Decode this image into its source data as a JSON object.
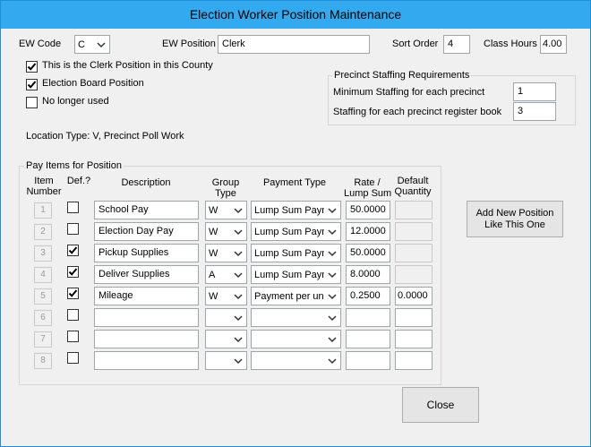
{
  "window": {
    "title": "Election Worker Position Maintenance"
  },
  "header": {
    "ew_code_label": "EW Code",
    "ew_code_value": "C",
    "ew_position_label": "EW Position",
    "ew_position_value": "Clerk",
    "sort_order_label": "Sort Order",
    "sort_order_value": "4",
    "class_hours_label": "Class Hours",
    "class_hours_value": "4.00"
  },
  "options": [
    {
      "label": "This is the Clerk Position in this County",
      "checked": true
    },
    {
      "label": "Election Board Position",
      "checked": true
    },
    {
      "label": "No longer used",
      "checked": false
    }
  ],
  "staffing": {
    "title": "Precinct Staffing Requirements",
    "min_label": "Minimum Staffing for each precinct",
    "min_value": "1",
    "book_label": "Staffing for each precinct register book",
    "book_value": "3"
  },
  "location_type": "Location Type: V, Precinct Poll Work",
  "pay_items": {
    "title": "Pay Items for Position",
    "headers": {
      "item_number": "Item\nNumber",
      "def": "Def.?",
      "description": "Description",
      "group_type": "Group\nType",
      "payment_type": "Payment Type",
      "rate": "Rate /\nLump Sum",
      "default_qty": "Default\nQuantity"
    },
    "rows": [
      {
        "num": "1",
        "def": false,
        "description": "School Pay",
        "group": "W",
        "payment": "Lump Sum Payment",
        "rate": "50.0000",
        "qty": "",
        "qty_enabled": false
      },
      {
        "num": "2",
        "def": false,
        "description": "Election Day Pay",
        "group": "W",
        "payment": "Lump Sum Payment",
        "rate": "12.0000",
        "qty": "",
        "qty_enabled": false
      },
      {
        "num": "3",
        "def": true,
        "description": "Pickup Supplies",
        "group": "W",
        "payment": "Lump Sum Payment",
        "rate": "50.0000",
        "qty": "",
        "qty_enabled": false
      },
      {
        "num": "4",
        "def": true,
        "description": "Deliver Supplies",
        "group": "A",
        "payment": "Lump Sum Payment",
        "rate": "8.0000",
        "qty": "",
        "qty_enabled": false
      },
      {
        "num": "5",
        "def": true,
        "description": "Mileage",
        "group": "W",
        "payment": "Payment per unit",
        "rate": "0.2500",
        "qty": "0.0000",
        "qty_enabled": true
      },
      {
        "num": "6",
        "def": false,
        "description": "",
        "group": "",
        "payment": "",
        "rate": "",
        "qty": "",
        "qty_enabled": true
      },
      {
        "num": "7",
        "def": false,
        "description": "",
        "group": "",
        "payment": "",
        "rate": "",
        "qty": "",
        "qty_enabled": true
      },
      {
        "num": "8",
        "def": false,
        "description": "",
        "group": "",
        "payment": "",
        "rate": "",
        "qty": "",
        "qty_enabled": true
      }
    ]
  },
  "buttons": {
    "add_new": "Add New Position\nLike This One",
    "close": "Close"
  }
}
